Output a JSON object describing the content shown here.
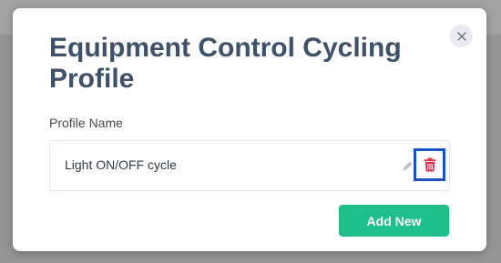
{
  "modal": {
    "title": "Equipment Control Cycling Profile",
    "close_icon": "close-icon",
    "field_label": "Profile Name",
    "profiles": [
      {
        "name": "Light ON/OFF cycle",
        "edit_icon": "pencil-icon",
        "delete_icon": "trash-icon"
      }
    ],
    "add_button_label": "Add New"
  },
  "colors": {
    "title": "#3f5168",
    "add_button": "#1fbf8b",
    "delete_icon": "#e0344f",
    "highlight_border": "#1852c4",
    "backdrop": "#959595"
  }
}
